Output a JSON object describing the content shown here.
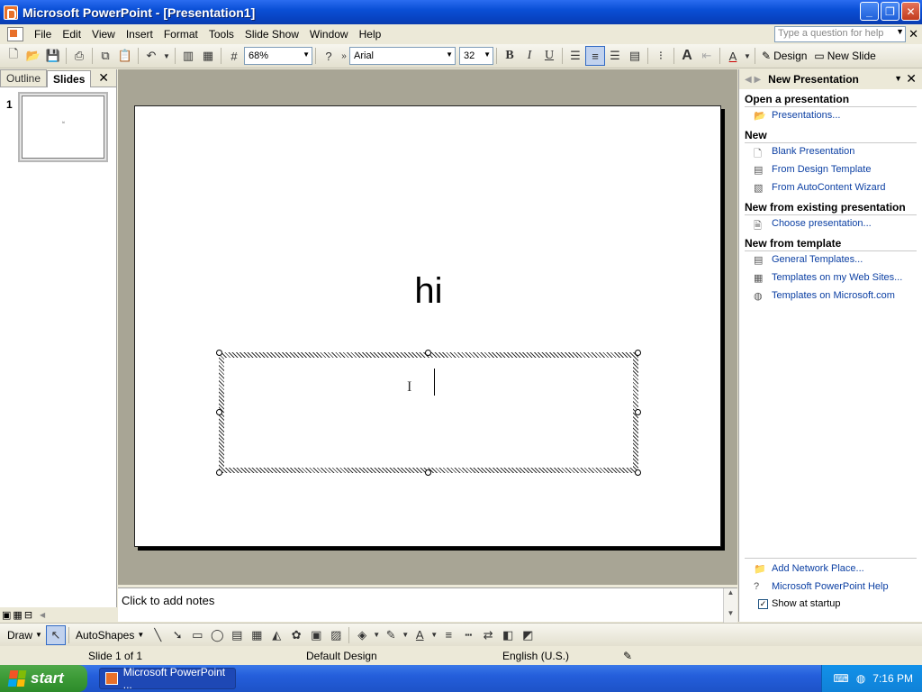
{
  "window": {
    "title": "Microsoft PowerPoint - [Presentation1]",
    "buttons": {
      "minimize": "_",
      "maximize": "❐",
      "close": "✕"
    }
  },
  "menubar": {
    "items": [
      "File",
      "Edit",
      "View",
      "Insert",
      "Format",
      "Tools",
      "Slide Show",
      "Window",
      "Help"
    ],
    "help_placeholder": "Type a question for help"
  },
  "toolbar": {
    "zoom": "68%",
    "font": "Arial",
    "font_size": "32",
    "bold": "B",
    "italic": "I",
    "underline": "U",
    "design_label": "Design",
    "new_slide_label": "New Slide"
  },
  "left_pane": {
    "tabs": [
      "Outline",
      "Slides"
    ],
    "selected_tab": "Slides",
    "slide_number": "1",
    "thumb_text": "hi"
  },
  "slide": {
    "title": "hi"
  },
  "notes": {
    "placeholder": "Click to add notes"
  },
  "task_pane": {
    "title": "New Presentation",
    "sections": [
      {
        "heading": "Open a presentation",
        "links": [
          {
            "label": "Presentations...",
            "icon": "folder-icon"
          }
        ]
      },
      {
        "heading": "New",
        "links": [
          {
            "label": "Blank Presentation",
            "icon": "blank-doc-icon"
          },
          {
            "label": "From Design Template",
            "icon": "template-icon"
          },
          {
            "label": "From AutoContent Wizard",
            "icon": "wizard-icon"
          }
        ]
      },
      {
        "heading": "New from existing presentation",
        "links": [
          {
            "label": "Choose presentation...",
            "icon": "doc-icon"
          }
        ]
      },
      {
        "heading": "New from template",
        "links": [
          {
            "label": "General Templates...",
            "icon": "template-icon"
          },
          {
            "label": "Templates on my Web Sites...",
            "icon": "web-template-icon"
          },
          {
            "label": "Templates on Microsoft.com",
            "icon": "globe-icon"
          }
        ]
      }
    ],
    "bottom_links": [
      {
        "label": "Add Network Place...",
        "icon": "network-folder-icon"
      },
      {
        "label": "Microsoft PowerPoint Help",
        "icon": "help-icon"
      }
    ],
    "show_at_startup": "Show at startup",
    "show_at_startup_checked": true
  },
  "drawbar": {
    "draw_label": "Draw",
    "autoshapes_label": "AutoShapes"
  },
  "statusbar": {
    "slide": "Slide 1 of 1",
    "design": "Default Design",
    "language": "English (U.S.)"
  },
  "taskbar": {
    "start_label": "start",
    "task_item": "Microsoft PowerPoint ...",
    "clock": "7:16 PM"
  },
  "colors": {
    "titlebar_blue": "#0a4fd6",
    "link_blue": "#0b3fa3",
    "canvas_gray": "#a8a595",
    "start_green": "#3b9a36"
  }
}
